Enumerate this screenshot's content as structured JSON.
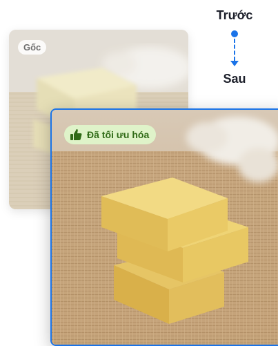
{
  "legend": {
    "before_label": "Trước",
    "after_label": "Sau"
  },
  "original": {
    "badge": "Gốc"
  },
  "optimized": {
    "badge": "Đã tối ưu hóa",
    "badge_icon": "thumbs-up-icon"
  },
  "colors": {
    "accent": "#1a73e8",
    "badge_green_bg": "#dff3c9",
    "badge_green_text": "#2f6a16"
  }
}
